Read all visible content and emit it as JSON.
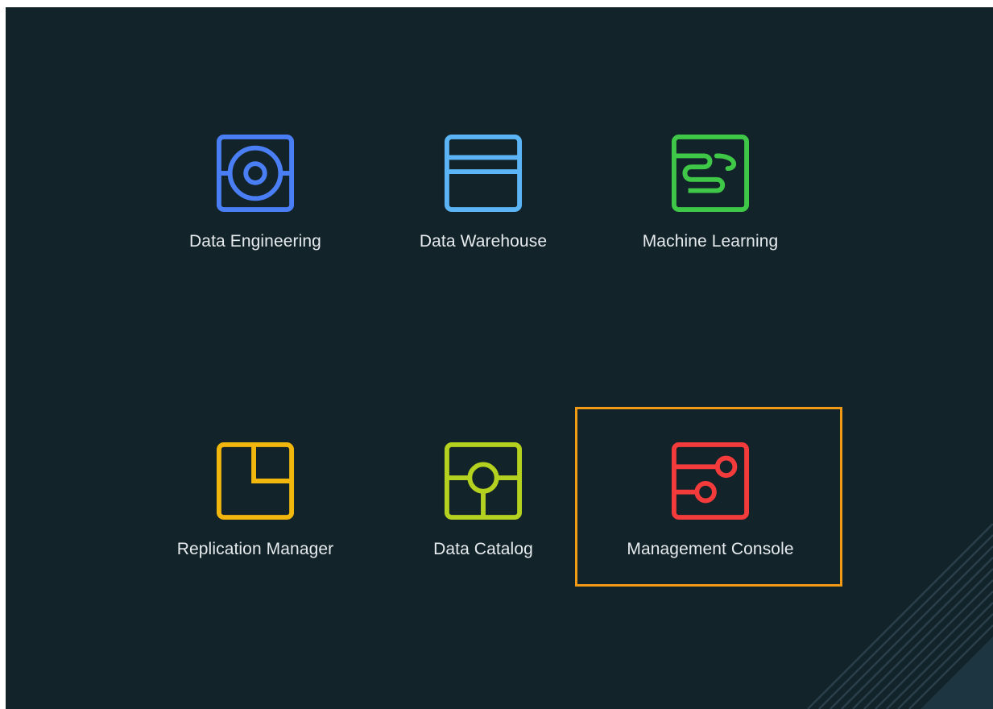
{
  "tiles": [
    {
      "label": "Data Engineering",
      "icon": "data-engineering-icon",
      "color": "#4a7ef5"
    },
    {
      "label": "Data Warehouse",
      "icon": "data-warehouse-icon",
      "color": "#5ab4f5"
    },
    {
      "label": "Machine Learning",
      "icon": "machine-learning-icon",
      "color": "#3fc747"
    },
    {
      "label": "Replication Manager",
      "icon": "replication-manager-icon",
      "color": "#f2b70d"
    },
    {
      "label": "Data Catalog",
      "icon": "data-catalog-icon",
      "color": "#b5d11f"
    },
    {
      "label": "Management Console",
      "icon": "management-console-icon",
      "color": "#f43b3b"
    }
  ],
  "theme": {
    "background": "#12232a",
    "highlight": "#f29a16",
    "label_color": "#e6ebee"
  },
  "selected_tile": "Management Console"
}
